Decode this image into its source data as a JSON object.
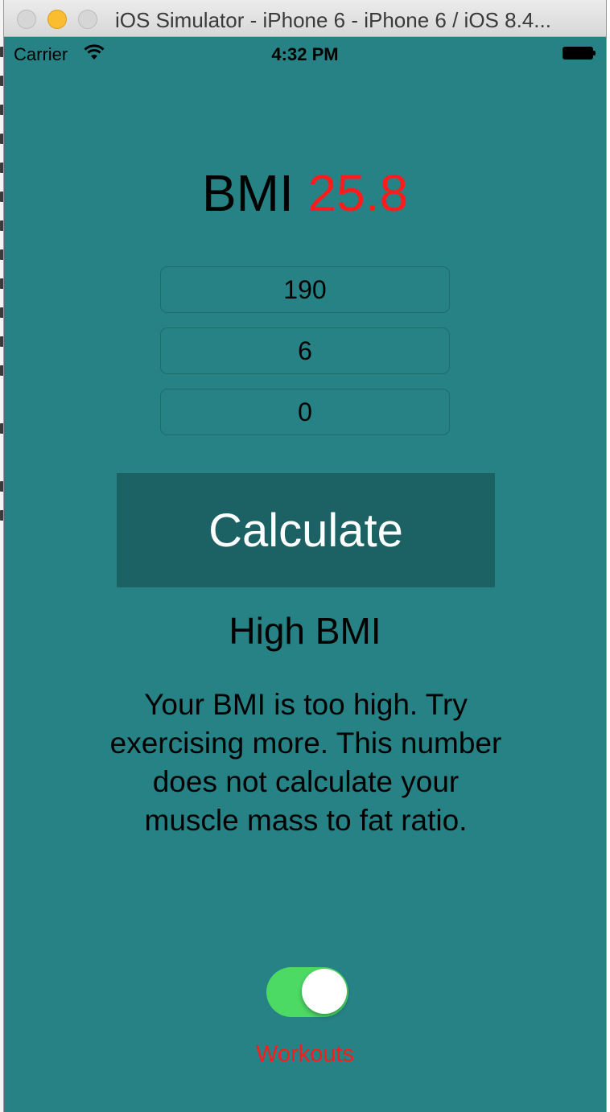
{
  "window": {
    "title": "iOS Simulator - iPhone 6 - iPhone 6 / iOS 8.4..."
  },
  "status_bar": {
    "carrier": "Carrier",
    "time": "4:32 PM"
  },
  "bmi": {
    "label": "BMI",
    "value": "25.8",
    "value_color": "#ff1b1b"
  },
  "inputs": {
    "weight": "190",
    "height_feet": "6",
    "height_inches": "0"
  },
  "calculate_button": {
    "label": "Calculate"
  },
  "result": {
    "title": "High BMI",
    "message": "Your BMI is too high. Try exercising more. This number does not calculate your muscle mass to fat ratio."
  },
  "workouts_toggle": {
    "label": "Workouts",
    "on": true,
    "on_color": "#4cd964"
  },
  "colors": {
    "background": "#268285",
    "button": "#1c6265",
    "accent_red": "#ff1b1b"
  }
}
